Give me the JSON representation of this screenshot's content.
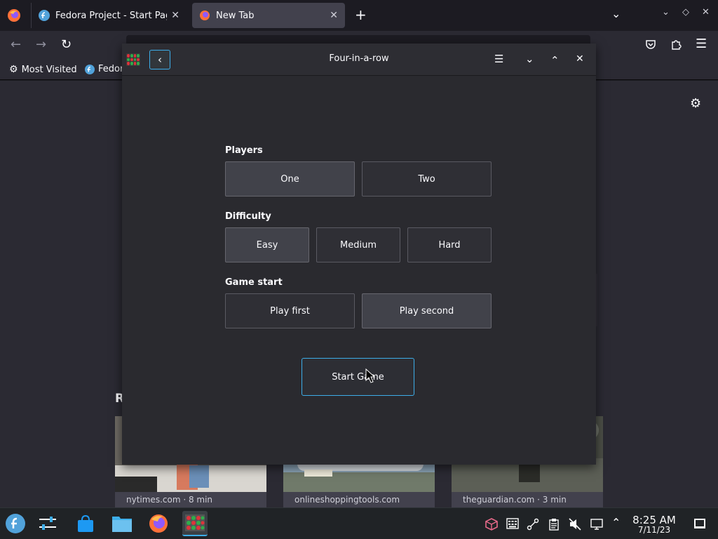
{
  "browser": {
    "tabs": [
      {
        "title": "Fedora Project - Start Page"
      },
      {
        "title": "New Tab"
      }
    ],
    "bookmarks": [
      {
        "label": "Most Visited"
      },
      {
        "label": "Fedor"
      }
    ]
  },
  "newtab": {
    "recent_letter": "R",
    "cards": [
      {
        "text": "nytimes.com · 8 min"
      },
      {
        "text": "onlineshoppingtools.com"
      },
      {
        "text": "theguardian.com · 3 min"
      }
    ]
  },
  "dialog": {
    "title": "Four-in-a-row",
    "players": {
      "label": "Players",
      "options": [
        "One",
        "Two"
      ],
      "selected": "One"
    },
    "difficulty": {
      "label": "Difficulty",
      "options": [
        "Easy",
        "Medium",
        "Hard"
      ],
      "selected": "Easy"
    },
    "game_start": {
      "label": "Game start",
      "options": [
        "Play first",
        "Play second"
      ],
      "selected": "Play second"
    },
    "start_button": "Start Game"
  },
  "taskbar": {
    "time": "8:25 AM",
    "date": "7/11/23"
  },
  "colors": {
    "accent": "#3daee9",
    "firefox_dark": "#1c1b22",
    "dialog_bg": "#2a2a2f"
  }
}
